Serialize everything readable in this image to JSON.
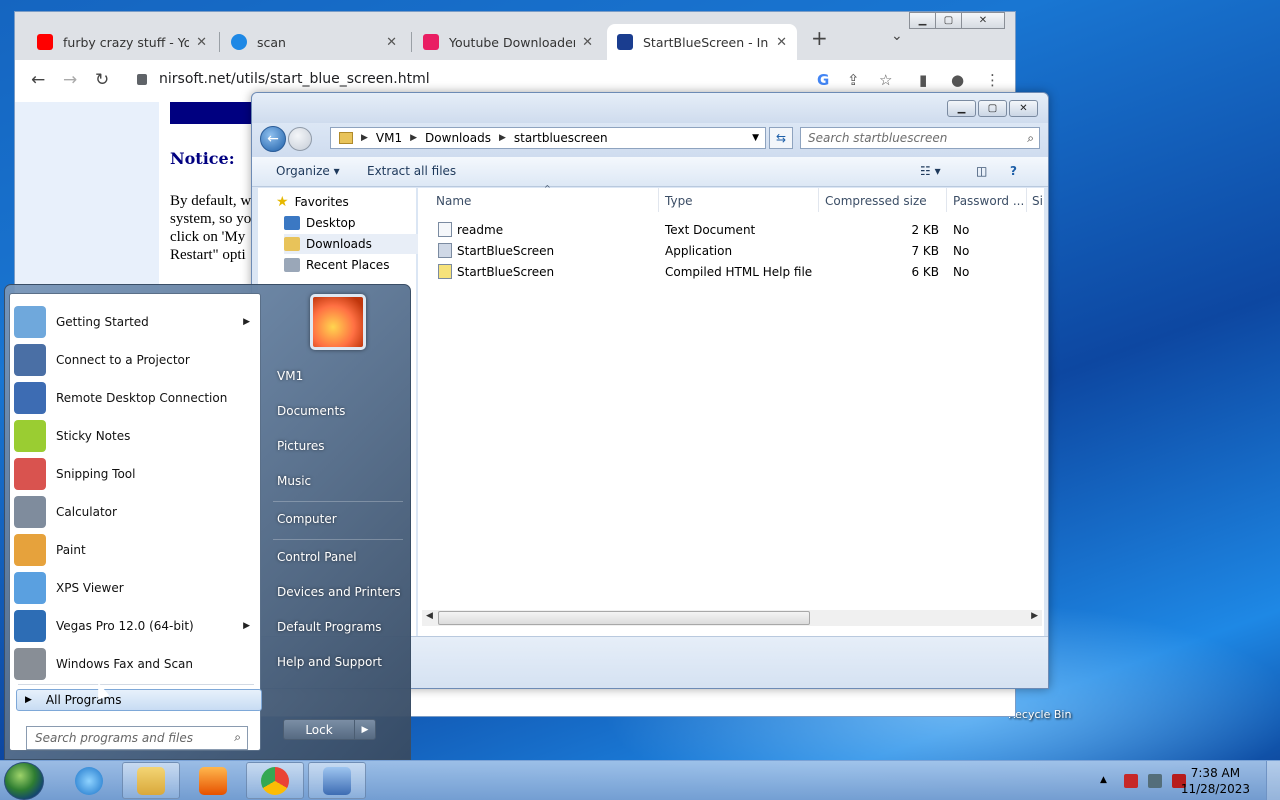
{
  "desktop": {
    "recycle_bin_label": "Recycle Bin"
  },
  "chrome": {
    "tabs": [
      {
        "title": "furby crazy stuff - YouTube"
      },
      {
        "title": "scan"
      },
      {
        "title": "Youtube Downloader - Conv"
      },
      {
        "title": "StartBlueScreen - Initiate"
      }
    ],
    "new_tab": "+",
    "url": "nirsoft.net/utils/start_blue_screen.html",
    "page": {
      "notice": "Notice:",
      "text_lines": [
        "By default, w",
        "system, so yo",
        "click on 'My",
        "Restart\" opti"
      ]
    }
  },
  "explorer": {
    "breadcrumb": [
      "VM1",
      "Downloads",
      "startbluescreen"
    ],
    "search_placeholder": "Search startbluescreen",
    "organize": "Organize ▾",
    "extract": "Extract all files",
    "nav": {
      "favorites": "Favorites",
      "items": [
        "Desktop",
        "Downloads",
        "Recent Places"
      ]
    },
    "columns": [
      "Name",
      "Type",
      "Compressed size",
      "Password ...",
      "Si"
    ],
    "files": [
      {
        "name": "readme",
        "type": "Text Document",
        "size": "2 KB",
        "password": "No"
      },
      {
        "name": "StartBlueScreen",
        "type": "Application",
        "size": "7 KB",
        "password": "No"
      },
      {
        "name": "StartBlueScreen",
        "type": "Compiled HTML Help file",
        "size": "6 KB",
        "password": "No"
      }
    ]
  },
  "start_menu": {
    "programs": [
      {
        "label": "Getting Started",
        "submenu": true,
        "color": "#6fa8dc"
      },
      {
        "label": "Connect to a Projector",
        "submenu": false,
        "color": "#4a6fa5"
      },
      {
        "label": "Remote Desktop Connection",
        "submenu": false,
        "color": "#3d6cb3"
      },
      {
        "label": "Sticky Notes",
        "submenu": false,
        "color": "#9acd32"
      },
      {
        "label": "Snipping Tool",
        "submenu": false,
        "color": "#d9534f"
      },
      {
        "label": "Calculator",
        "submenu": false,
        "color": "#7f8c9d"
      },
      {
        "label": "Paint",
        "submenu": false,
        "color": "#e6a23c"
      },
      {
        "label": "XPS Viewer",
        "submenu": false,
        "color": "#5aa0e0"
      },
      {
        "label": "Vegas Pro 12.0 (64-bit)",
        "submenu": true,
        "color": "#2d6db5"
      },
      {
        "label": "Windows Fax and Scan",
        "submenu": false,
        "color": "#888e96"
      }
    ],
    "all_programs": "All Programs",
    "search_placeholder": "Search programs and files",
    "right_items": [
      "VM1",
      "Documents",
      "Pictures",
      "Music",
      "Computer",
      "Control Panel",
      "Devices and Printers",
      "Default Programs",
      "Help and Support"
    ],
    "lock": "Lock"
  },
  "taskbar": {
    "time": "7:38 AM",
    "date": "11/28/2023"
  }
}
